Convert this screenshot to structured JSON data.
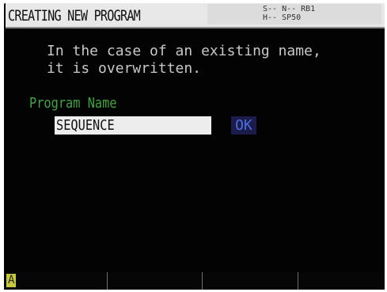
{
  "header": {
    "title": "CREATING NEW PROGRAM",
    "status_line1": "S-- N-- RB1",
    "status_line2": "H--     SP50"
  },
  "message": {
    "line1": "In the case of an existing name,",
    "line2": "it is overwritten."
  },
  "form": {
    "label": "Program Name",
    "value": "SEQUENCE",
    "ok_label": "OK"
  },
  "function_keys": {
    "key1_label": "A",
    "key2_label": "",
    "key3_label": "",
    "key4_label": ""
  },
  "colors": {
    "label_green": "#3fa53f",
    "ok_blue": "#4c6ee0",
    "field_bg": "#ededed",
    "screen_bg": "#030303"
  }
}
